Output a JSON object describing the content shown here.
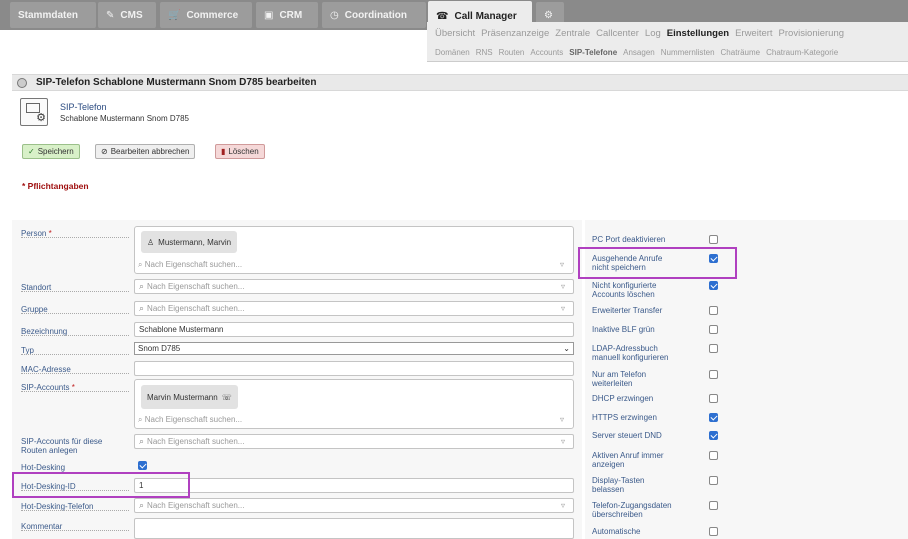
{
  "main_tabs": [
    {
      "label": "Stammdaten",
      "icon": "none"
    },
    {
      "label": "CMS",
      "icon": "pencil-icon"
    },
    {
      "label": "Commerce",
      "icon": "cart-icon"
    },
    {
      "label": "CRM",
      "icon": "contacts-icon"
    },
    {
      "label": "Coordination",
      "icon": "clock-icon"
    },
    {
      "label": "Call Manager",
      "icon": "phone-icon"
    },
    {
      "label": "",
      "icon": "settings-icon"
    }
  ],
  "subnav1": [
    "Übersicht",
    "Präsenzanzeige",
    "Zentrale",
    "Callcenter",
    "Log",
    "Einstellungen",
    "Erweitert",
    "Provisionierung"
  ],
  "subnav1_active": "Einstellungen",
  "subnav2": [
    "Domänen",
    "RNS",
    "Routen",
    "Accounts",
    "SIP-Telefone",
    "Ansagen",
    "Nummernlisten",
    "Chaträume",
    "Chatraum-Kategorie"
  ],
  "subnav2_active": "SIP-Telefone",
  "page_title": "SIP-Telefon Schablone Mustermann Snom D785 bearbeiten",
  "header": {
    "type": "SIP-Telefon",
    "name": "Schablone Mustermann Snom D785"
  },
  "buttons": {
    "save": "Speichern",
    "cancel": "Bearbeiten abbrechen",
    "delete": "Löschen"
  },
  "required_note": "* Pflichtangaben",
  "search_placeholder": "Nach Eigenschaft suchen...",
  "fields": {
    "person": {
      "label": "Person",
      "tag": "Mustermann, Marvin"
    },
    "standort": {
      "label": "Standort"
    },
    "gruppe": {
      "label": "Gruppe"
    },
    "bezeichnung": {
      "label": "Bezeichnung",
      "value": "Schablone Mustermann"
    },
    "typ": {
      "label": "Typ",
      "value": "Snom D785"
    },
    "mac": {
      "label": "MAC-Adresse"
    },
    "sip_accounts": {
      "label": "SIP-Accounts",
      "tag": "Marvin Mustermann"
    },
    "sip_accounts_routes": {
      "label_1": "SIP-Accounts für diese",
      "label_2": "Routen anlegen"
    },
    "hot_desking": {
      "label": "Hot-Desking",
      "checked": true
    },
    "hot_desking_id": {
      "label": "Hot-Desking-ID",
      "value": "1"
    },
    "hot_desking_telefon": {
      "label": "Hot-Desking-Telefon"
    },
    "kommentar": {
      "label": "Kommentar"
    }
  },
  "right_options": [
    {
      "label_1": "PC Port deaktivieren",
      "label_2": "",
      "checked": false
    },
    {
      "label_1": "Ausgehende Anrufe",
      "label_2": "nicht speichern",
      "checked": true
    },
    {
      "label_1": "Nicht konfigurierte",
      "label_2": "Accounts löschen",
      "checked": true
    },
    {
      "label_1": "Erweiterter Transfer",
      "label_2": "",
      "checked": false
    },
    {
      "label_1": "Inaktive BLF grün",
      "label_2": "",
      "checked": false
    },
    {
      "label_1": "LDAP-Adressbuch",
      "label_2": "manuell konfigurieren",
      "checked": false
    },
    {
      "label_1": "Nur am Telefon",
      "label_2": "weiterleiten",
      "checked": false
    },
    {
      "label_1": "DHCP erzwingen",
      "label_2": "",
      "checked": false
    },
    {
      "label_1": "HTTPS erzwingen",
      "label_2": "",
      "checked": true
    },
    {
      "label_1": "Server steuert DND",
      "label_2": "",
      "checked": true
    },
    {
      "label_1": "Aktiven Anruf immer",
      "label_2": "anzeigen",
      "checked": false
    },
    {
      "label_1": "Display-Tasten",
      "label_2": "belassen",
      "checked": false
    },
    {
      "label_1": "Telefon-Zugangsdaten",
      "label_2": "überschreiben",
      "checked": false
    },
    {
      "label_1": "Automatische",
      "label_2": "",
      "checked": false
    }
  ],
  "highlight_color": "#b040c0"
}
